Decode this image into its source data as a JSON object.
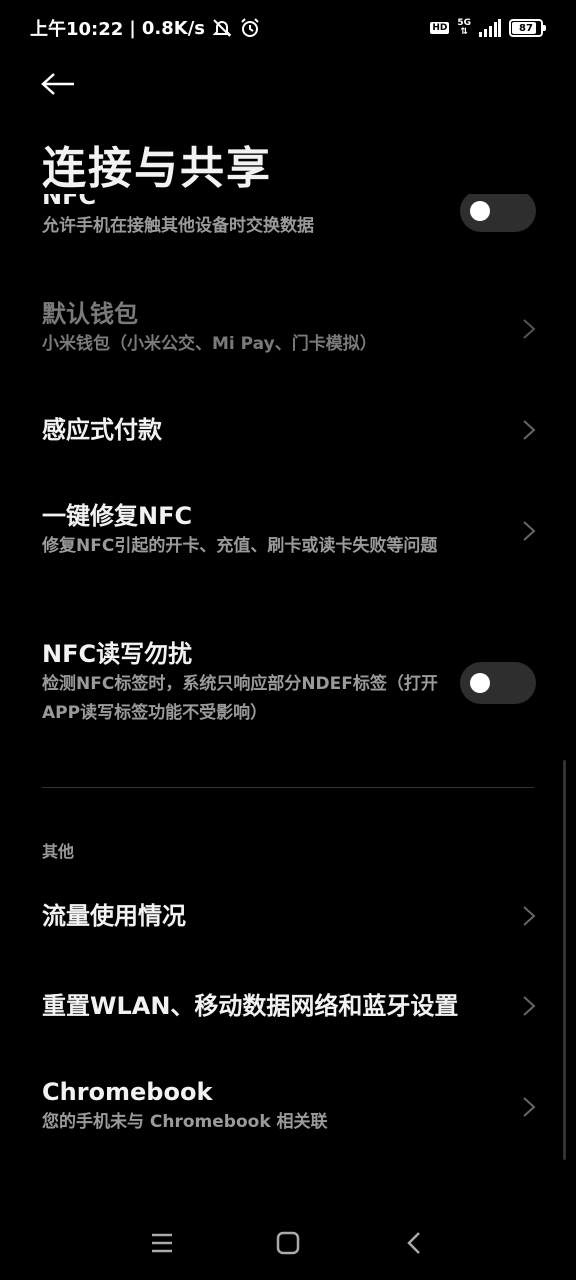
{
  "status_bar": {
    "time": "上午10:22",
    "separator": "|",
    "net_speed": "0.8K/s",
    "hd_label": "HD",
    "network_type": "5G",
    "battery_level": "87"
  },
  "header": {
    "title": "连接与共享"
  },
  "items": {
    "nfc": {
      "title": "NFC",
      "subtitle": "允许手机在接触其他设备时交换数据",
      "toggle_on": false
    },
    "default_wallet": {
      "title": "默认钱包",
      "subtitle": "小米钱包（小米公交、Mi Pay、门卡模拟）"
    },
    "tap_pay": {
      "title": "感应式付款"
    },
    "nfc_repair": {
      "title": "一键修复NFC",
      "subtitle": "修复NFC引起的开卡、充值、刷卡或读卡失败等问题"
    },
    "nfc_dnd": {
      "title": "NFC读写勿扰",
      "subtitle": "检测NFC标签时，系统只响应部分NDEF标签（打开APP读写标签功能不受影响）",
      "toggle_on": false
    }
  },
  "other_section": {
    "label": "其他",
    "data_usage": {
      "title": "流量使用情况"
    },
    "reset_network": {
      "title": "重置WLAN、移动数据网络和蓝牙设置"
    },
    "chromebook": {
      "title": "Chromebook",
      "subtitle": "您的手机未与 Chromebook 相关联"
    }
  },
  "colors": {
    "background": "#000000",
    "text_primary": "#f2f2f2",
    "text_secondary": "#9a9a9a",
    "toggle_track": "#2e2e2e"
  }
}
